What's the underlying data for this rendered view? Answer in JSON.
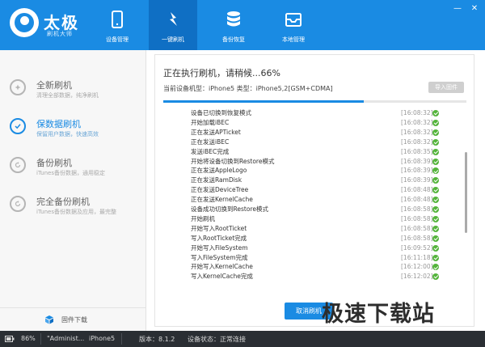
{
  "app": {
    "title": "太极",
    "subtitle": "刷机大师"
  },
  "nav": {
    "tabs": [
      {
        "label": "设备管理",
        "icon": "phone-icon"
      },
      {
        "label": "一键刷机",
        "icon": "flash-icon",
        "active": true
      },
      {
        "label": "备份恢复",
        "icon": "database-icon"
      },
      {
        "label": "本地管理",
        "icon": "inbox-icon"
      }
    ]
  },
  "window": {
    "minimize": "—",
    "close": "✕"
  },
  "sidebar": {
    "items": [
      {
        "title": "全新刷机",
        "desc": "清理全部数据，纯净刷机",
        "active": false
      },
      {
        "title": "保数据刷机",
        "desc": "保留用户数据，快速高效",
        "active": true
      },
      {
        "title": "备份刷机",
        "desc": "iTunes备份数据，通用稳定",
        "active": false
      },
      {
        "title": "完全备份刷机",
        "desc": "iTunes备份数据及应用，最完整",
        "active": false
      }
    ],
    "footer_label": "固件下载"
  },
  "flash": {
    "status_title": "正在执行刷机，请稍候...66%",
    "progress_percent": 66,
    "device_info": "当前设备机型：iPhone5 类型：iPhone5,2[GSM+CDMA]",
    "import_label": "导入固件",
    "cancel_label": "取消刷机",
    "log": [
      {
        "msg": "设备已切换到恢复模式",
        "ts": "[16:08:32]"
      },
      {
        "msg": "开始加载iBEC",
        "ts": "[16:08:32]"
      },
      {
        "msg": "正在发送APTicket",
        "ts": "[16:08:32]"
      },
      {
        "msg": "正在发送iBEC",
        "ts": "[16:08:32]"
      },
      {
        "msg": "发送iBEC完成",
        "ts": "[16:08:35]"
      },
      {
        "msg": "开始将设备切换到Restore模式",
        "ts": "[16:08:39]"
      },
      {
        "msg": "正在发送AppleLogo",
        "ts": "[16:08:39]"
      },
      {
        "msg": "正在发送RamDisk",
        "ts": "[16:08:39]"
      },
      {
        "msg": "正在发送DeviceTree",
        "ts": "[16:08:48]"
      },
      {
        "msg": "正在发送KernelCache",
        "ts": "[16:08:48]"
      },
      {
        "msg": "设备成功切换到Restore模式",
        "ts": "[16:08:58]"
      },
      {
        "msg": "开始刷机",
        "ts": "[16:08:58]"
      },
      {
        "msg": "开始写入RootTicket",
        "ts": "[16:08:58]"
      },
      {
        "msg": "写入RootTicket完成",
        "ts": "[16:08:58]"
      },
      {
        "msg": "开始写入FileSystem",
        "ts": "[16:09:52]"
      },
      {
        "msg": "写入FileSystem完成",
        "ts": "[16:11:18]"
      },
      {
        "msg": "开始写入KernelCache",
        "ts": "[16:12:00]"
      },
      {
        "msg": "写入KernelCache完成",
        "ts": "[16:12:02]"
      }
    ]
  },
  "watermark": "极速下载站",
  "statusbar": {
    "battery": "86%",
    "device_name": "\"Administ...",
    "model": "iPhone5",
    "version": "版本：8.1.2",
    "device_state": "设备状态：正常连接"
  },
  "colors": {
    "brand": "#1a8be3",
    "nav_active": "#0f6fc4",
    "success": "#54b43b",
    "statusbar": "#2a2e33"
  }
}
